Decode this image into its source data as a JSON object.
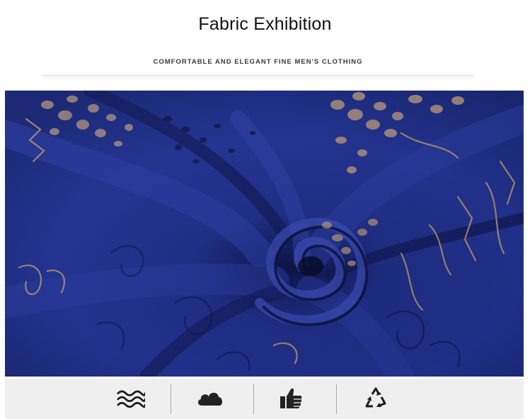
{
  "header": {
    "title": "Fabric Exhibition",
    "subtitle": "COMFORTABLE AND ELEGANT FINE MEN'S CLOTHING"
  },
  "fabric_image": {
    "description_name": "navy-printed-fabric-swirl",
    "colors": {
      "base": "#1c2a78",
      "deep": "#0d1448",
      "highlight": "#3546a8",
      "print": "#c7a27a"
    }
  },
  "features": {
    "icons": [
      "waves-icon",
      "cloud-icon",
      "thumbs-up-icon",
      "recycle-icon"
    ]
  }
}
